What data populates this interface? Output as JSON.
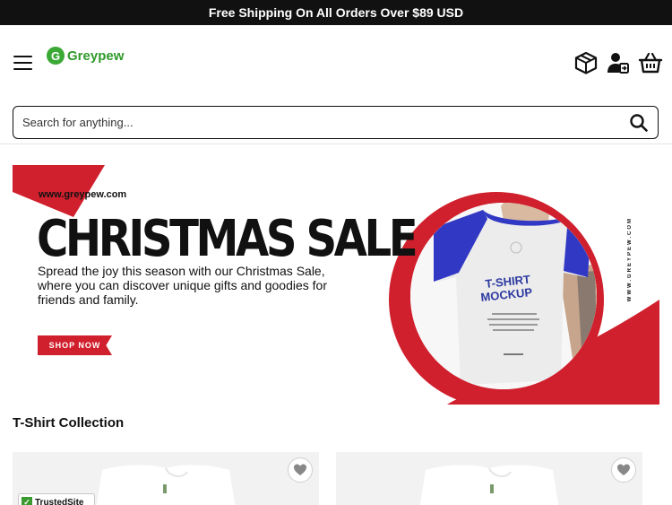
{
  "topbar": {
    "text": "Free Shipping On All Orders Over $89 USD"
  },
  "header": {
    "logo_mark": "G",
    "logo_text": "Greypew",
    "icons": [
      "menu-icon",
      "package-icon",
      "account-icon",
      "cart-icon"
    ]
  },
  "search": {
    "placeholder": "Search for anything...",
    "icon": "search-icon"
  },
  "banner": {
    "url": "www.greypew.com",
    "title": "CHRISTMAS SALE",
    "description": "Spread the joy this season with our Christmas Sale, where you can discover unique gifts and goodies for friends and family.",
    "cta": "SHOP NOW",
    "vertical_url": "WWW.GREYPEW.COM",
    "mockup_title_1": "T-SHIRT",
    "mockup_title_2": "MOCKUP",
    "accent_color": "#d0202d",
    "sleeve_color": "#3138c4"
  },
  "section": {
    "title": "T-Shirt Collection"
  },
  "products": [
    {
      "wishlist_icon": "heart-icon"
    },
    {
      "wishlist_icon": "heart-icon"
    }
  ],
  "badge": {
    "text": "TrustedSite"
  }
}
